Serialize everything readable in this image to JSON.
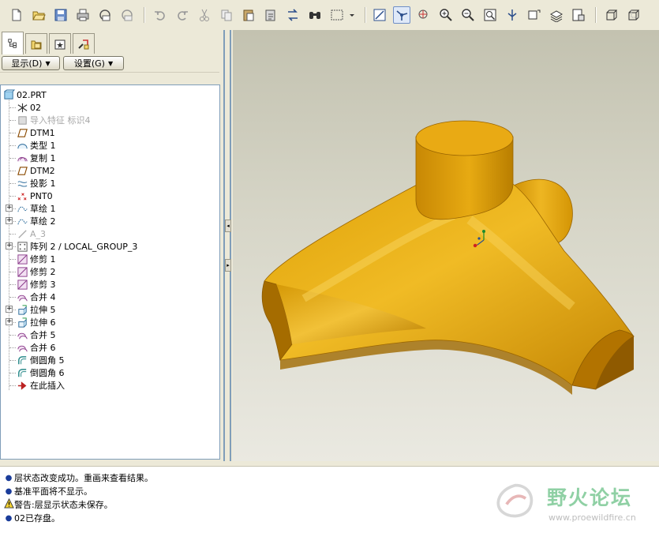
{
  "toolbar": {
    "icons": [
      "new-file-icon",
      "open-folder-icon",
      "save-icon",
      "print-icon",
      "email-icon",
      "send-icon",
      "undo-icon",
      "redo-icon",
      "cut-icon",
      "copy-icon",
      "paste-icon",
      "paste-special-icon",
      "regenerate-icon",
      "find-icon",
      "select-box-icon",
      "dropdown-icon",
      "datum-display-icon",
      "spin-center-icon",
      "orient-icon",
      "zoom-in-icon",
      "zoom-out-icon",
      "refit-icon",
      "reorient-icon",
      "saved-views-icon",
      "layers-icon",
      "view-manager-icon",
      "wireframe-icon",
      "hidden-line-icon"
    ]
  },
  "panel": {
    "tabs": [
      "model-tree-tab",
      "folder-browser-tab",
      "favorites-tab",
      "connections-tab"
    ],
    "show_menu": "显示(D)",
    "settings_menu": "设置(G)"
  },
  "tree": {
    "items": [
      {
        "label": "02.PRT",
        "icon": "part-icon",
        "grey": false,
        "expand": false
      },
      {
        "label": "02",
        "icon": "csys-icon",
        "grey": false,
        "expand": false
      },
      {
        "label": "导入特征 标识4",
        "icon": "import-feature-icon",
        "grey": true,
        "expand": false
      },
      {
        "label": "DTM1",
        "icon": "datum-plane-icon",
        "grey": false,
        "expand": false
      },
      {
        "label": "类型 1",
        "icon": "surface-icon",
        "grey": false,
        "expand": false
      },
      {
        "label": "复制 1",
        "icon": "copy-surface-icon",
        "grey": false,
        "expand": false
      },
      {
        "label": "DTM2",
        "icon": "datum-plane-icon",
        "grey": false,
        "expand": false
      },
      {
        "label": "投影 1",
        "icon": "project-curve-icon",
        "grey": false,
        "expand": false
      },
      {
        "label": "PNT0",
        "icon": "datum-point-icon",
        "grey": false,
        "expand": false
      },
      {
        "label": "草绘 1",
        "icon": "sketch-icon",
        "grey": false,
        "expand": true
      },
      {
        "label": "草绘 2",
        "icon": "sketch-icon",
        "grey": false,
        "expand": true
      },
      {
        "label": "A_3",
        "icon": "datum-axis-icon",
        "grey": true,
        "expand": false
      },
      {
        "label": "阵列 2 / LOCAL_GROUP_3",
        "icon": "pattern-icon",
        "grey": false,
        "expand": true
      },
      {
        "label": "修剪 1",
        "icon": "trim-icon",
        "grey": false,
        "expand": false
      },
      {
        "label": "修剪 2",
        "icon": "trim-icon",
        "grey": false,
        "expand": false
      },
      {
        "label": "修剪 3",
        "icon": "trim-icon",
        "grey": false,
        "expand": false
      },
      {
        "label": "合并 4",
        "icon": "merge-icon",
        "grey": false,
        "expand": false
      },
      {
        "label": "拉伸 5",
        "icon": "extrude-icon",
        "grey": false,
        "expand": true
      },
      {
        "label": "拉伸 6",
        "icon": "extrude-icon",
        "grey": false,
        "expand": true
      },
      {
        "label": "合并 5",
        "icon": "merge-icon",
        "grey": false,
        "expand": false
      },
      {
        "label": "合并 6",
        "icon": "merge-icon",
        "grey": false,
        "expand": false
      },
      {
        "label": "倒圆角 5",
        "icon": "round-icon",
        "grey": false,
        "expand": false
      },
      {
        "label": "倒圆角 6",
        "icon": "round-icon",
        "grey": false,
        "expand": false
      },
      {
        "label": "在此插入",
        "icon": "insert-here-icon",
        "grey": false,
        "expand": false
      }
    ]
  },
  "messages": [
    {
      "bullet": "info",
      "text": "层状态改变成功。重画来查看结果。"
    },
    {
      "bullet": "info",
      "text": "基准平面将不显示。"
    },
    {
      "bullet": "warning",
      "text": "警告:层显示状态未保存。"
    },
    {
      "bullet": "info",
      "text": "02已存盘。"
    }
  ],
  "watermark": {
    "brand": "野火论坛",
    "url": "www.proewildfire.cn"
  },
  "colors": {
    "model": "#d99a06",
    "model_dark": "#a86f00",
    "model_light": "#f2c23a",
    "accent": "#1a3c9a"
  }
}
